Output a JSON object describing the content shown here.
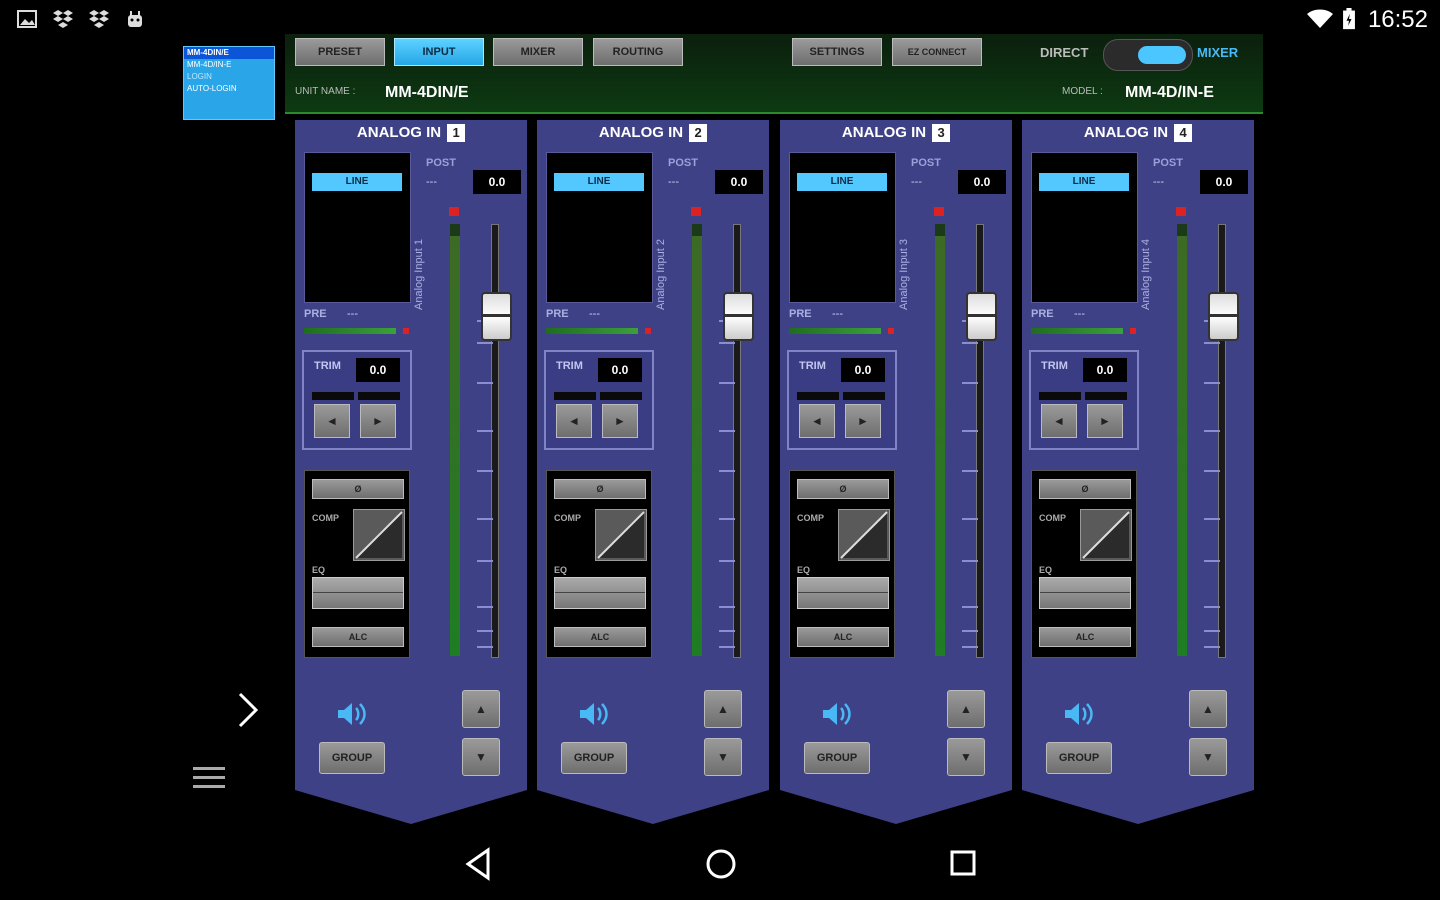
{
  "status_bar": {
    "time": "16:52",
    "left_icons": [
      "gallery-icon",
      "dropbox-icon",
      "dropbox-icon",
      "android-icon"
    ],
    "right_icons": [
      "wifi-icon",
      "battery-icon"
    ]
  },
  "unit_list": {
    "items": [
      {
        "label": "MM-4DIN/E",
        "selected": true
      },
      {
        "label": "MM-4D/IN-E",
        "selected": false
      },
      {
        "label": "LOGIN",
        "selected": false
      },
      {
        "label": "AUTO-LOGIN",
        "selected": false
      }
    ]
  },
  "header": {
    "tabs": [
      {
        "label": "PRESET",
        "active": false
      },
      {
        "label": "INPUT",
        "active": true
      },
      {
        "label": "MIXER",
        "active": false
      },
      {
        "label": "ROUTING",
        "active": false
      }
    ],
    "settings_label": "SETTINGS",
    "ezconnect_label": "EZ CONNECT",
    "mode_left": "DIRECT",
    "mode_right": "MIXER",
    "unit_name_label": "UNIT NAME :",
    "unit_name": "MM-4DIN/E",
    "model_label": "MODEL :",
    "model": "MM-4D/IN-E"
  },
  "channels": [
    {
      "title": "ANALOG IN",
      "number": "1",
      "input": "LINE",
      "post_label": "POST",
      "post_value": "---",
      "fader_value": "0.0",
      "vertical_label": "Analog Input 1",
      "pre_label": "PRE",
      "pre_value": "---",
      "trim_label": "TRIM",
      "trim_value": "0.0",
      "left": "◄",
      "right": "►",
      "phase": "Ø",
      "comp": "COMP",
      "eq": "EQ",
      "alc": "ALC",
      "group": "GROUP",
      "up": "▲",
      "down": "▼"
    },
    {
      "title": "ANALOG IN",
      "number": "2",
      "input": "LINE",
      "post_label": "POST",
      "post_value": "---",
      "fader_value": "0.0",
      "vertical_label": "Analog Input 2",
      "pre_label": "PRE",
      "pre_value": "---",
      "trim_label": "TRIM",
      "trim_value": "0.0",
      "left": "◄",
      "right": "►",
      "phase": "Ø",
      "comp": "COMP",
      "eq": "EQ",
      "alc": "ALC",
      "group": "GROUP",
      "up": "▲",
      "down": "▼"
    },
    {
      "title": "ANALOG IN",
      "number": "3",
      "input": "LINE",
      "post_label": "POST",
      "post_value": "---",
      "fader_value": "0.0",
      "vertical_label": "Analog Input 3",
      "pre_label": "PRE",
      "pre_value": "---",
      "trim_label": "TRIM",
      "trim_value": "0.0",
      "left": "◄",
      "right": "►",
      "phase": "Ø",
      "comp": "COMP",
      "eq": "EQ",
      "alc": "ALC",
      "group": "GROUP",
      "up": "▲",
      "down": "▼"
    },
    {
      "title": "ANALOG IN",
      "number": "4",
      "input": "LINE",
      "post_label": "POST",
      "post_value": "---",
      "fader_value": "0.0",
      "vertical_label": "Analog Input 4",
      "pre_label": "PRE",
      "pre_value": "---",
      "trim_label": "TRIM",
      "trim_value": "0.0",
      "left": "◄",
      "right": "►",
      "phase": "Ø",
      "comp": "COMP",
      "eq": "EQ",
      "alc": "ALC",
      "group": "GROUP",
      "up": "▲",
      "down": "▼"
    }
  ],
  "colors": {
    "strip": "#3f4187",
    "accent": "#4cc6ff",
    "header_green": "#0d3a12"
  }
}
